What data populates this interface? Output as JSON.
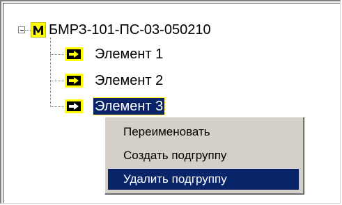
{
  "tree": {
    "root": {
      "label": "БМРЗ-101-ПС-03-050210",
      "icon": "module-m-icon"
    },
    "children": [
      {
        "label": "Элемент 1",
        "icon": "arrow-right-icon",
        "selected": false
      },
      {
        "label": "Элемент 2",
        "icon": "arrow-right-icon",
        "selected": false
      },
      {
        "label": "Элемент 3",
        "icon": "arrow-right-icon",
        "selected": true
      }
    ]
  },
  "context_menu": {
    "items": [
      {
        "label": "Переименовать",
        "highlighted": false
      },
      {
        "label": "Создать подгруппу",
        "highlighted": false
      },
      {
        "label": "Удалить подгруппу",
        "highlighted": true
      }
    ]
  },
  "colors": {
    "selection_bg": "#0a246a",
    "icon_yellow": "#ffff00",
    "menu_bg": "#d4d0c8"
  }
}
